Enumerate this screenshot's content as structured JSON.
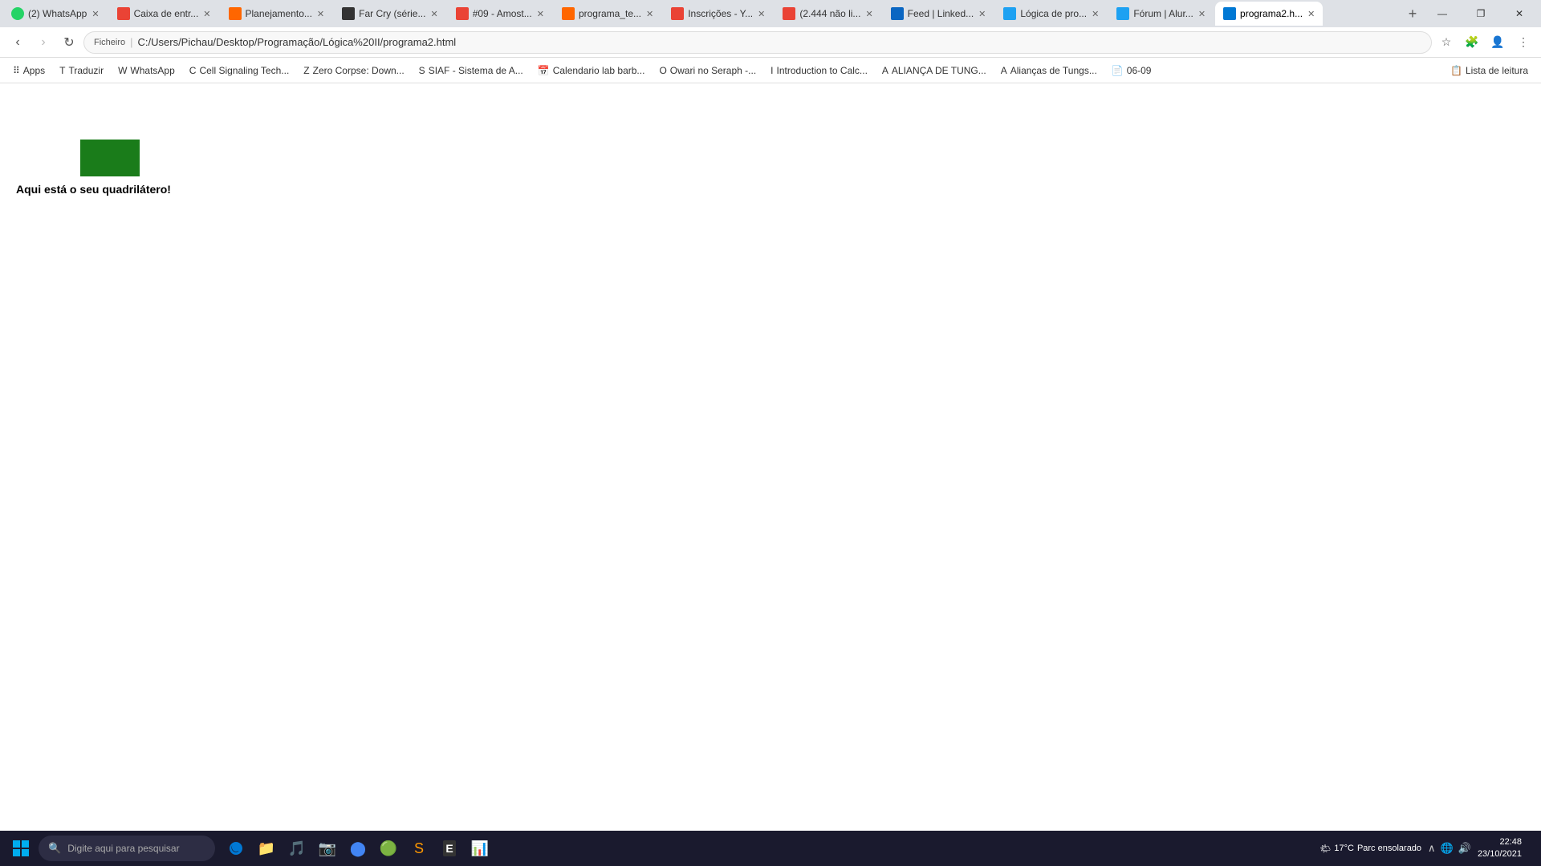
{
  "titlebar": {
    "tabs": [
      {
        "id": "tab-whatsapp",
        "label": "(2) WhatsApp",
        "favicon_color": "favicon-green",
        "active": false
      },
      {
        "id": "tab-gmail",
        "label": "Caixa de entr...",
        "favicon_color": "favicon-red",
        "active": false
      },
      {
        "id": "tab-planejamento",
        "label": "Planejamento...",
        "favicon_color": "favicon-orange",
        "active": false
      },
      {
        "id": "tab-farcry",
        "label": "Far Cry (série...",
        "favicon_color": "favicon-dark",
        "active": false
      },
      {
        "id": "tab-amostras",
        "label": "#09 - Amost...",
        "favicon_color": "favicon-red",
        "active": false
      },
      {
        "id": "tab-programa",
        "label": "programa_te...",
        "favicon_color": "favicon-orange",
        "active": false
      },
      {
        "id": "tab-inscricoes",
        "label": "Inscrições - Y...",
        "favicon_color": "favicon-red",
        "active": false
      },
      {
        "id": "tab-2444",
        "label": "(2.444 não li...",
        "favicon_color": "favicon-red",
        "active": false
      },
      {
        "id": "tab-linkedin",
        "label": "Feed | Linked...",
        "favicon_color": "favicon-lnk",
        "active": false
      },
      {
        "id": "tab-logica",
        "label": "Lógica de pro...",
        "favicon_color": "favicon-alura",
        "active": false
      },
      {
        "id": "tab-forum",
        "label": "Fórum | Alur...",
        "favicon_color": "favicon-alura",
        "active": false
      },
      {
        "id": "tab-programa2",
        "label": "programa2.h...",
        "favicon_color": "favicon-edge",
        "active": true
      }
    ],
    "window_controls": {
      "minimize": "—",
      "maximize": "❐",
      "close": "✕"
    }
  },
  "navbar": {
    "back_disabled": false,
    "forward_disabled": true,
    "reload_label": "↻",
    "address": "C:/Users/Pichau/Desktop/Programação/Lógica%20II/programa2.html",
    "address_label": "Ficheiro",
    "star_label": "☆",
    "extensions_label": "🧩"
  },
  "bookmarks": {
    "items": [
      {
        "id": "bm-apps",
        "label": "Apps",
        "icon": "⠿"
      },
      {
        "id": "bm-traduzir",
        "label": "Traduzir",
        "icon": "T"
      },
      {
        "id": "bm-whatsapp",
        "label": "WhatsApp",
        "icon": "W"
      },
      {
        "id": "bm-cellsig",
        "label": "Cell Signaling Tech...",
        "icon": "C"
      },
      {
        "id": "bm-zerocorpse",
        "label": "Zero Corpse: Down...",
        "icon": "Z"
      },
      {
        "id": "bm-siaf",
        "label": "SIAF - Sistema de A...",
        "icon": "S"
      },
      {
        "id": "bm-calendario",
        "label": "Calendario lab barb...",
        "icon": "📅"
      },
      {
        "id": "bm-owari",
        "label": "Owari no Seraph -...",
        "icon": "O"
      },
      {
        "id": "bm-intro-calc",
        "label": "Introduction to Calc...",
        "icon": "I"
      },
      {
        "id": "bm-alianca-tung",
        "label": "ALIANÇA DE TUNG...",
        "icon": "A"
      },
      {
        "id": "bm-aliancas",
        "label": "Alianças de Tungs...",
        "icon": "A"
      },
      {
        "id": "bm-0609",
        "label": "06-09",
        "icon": "📄"
      }
    ],
    "reading_list_label": "Lista de leitura"
  },
  "content": {
    "rect_color": "#1a7c1a",
    "text": "Aqui está o seu quadrilátero!"
  },
  "taskbar": {
    "search_placeholder": "Digite aqui para pesquisar",
    "weather": {
      "temp": "17°C",
      "condition": "Parc ensolarado"
    },
    "time": "22:48",
    "date": "23/10/2021"
  }
}
